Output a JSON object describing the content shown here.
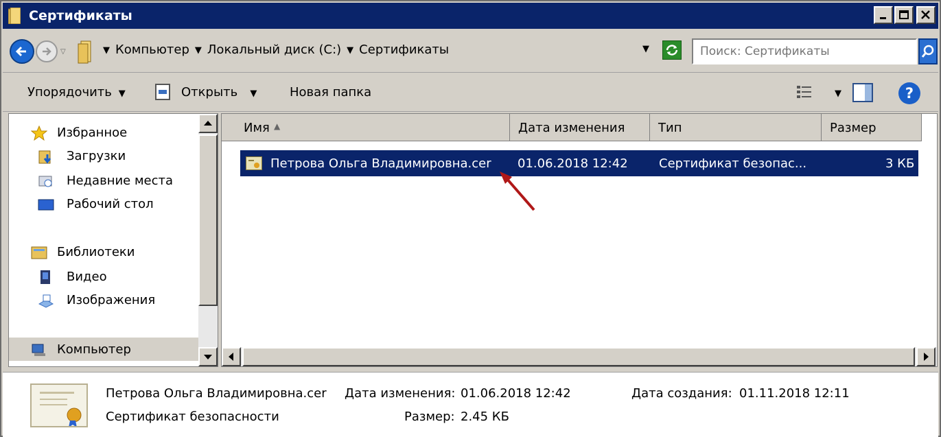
{
  "window": {
    "title": "Сертификаты",
    "controls": {
      "minimize": "minimize",
      "maximize": "maximize",
      "close": "close"
    }
  },
  "address": {
    "crumbs": [
      "Компьютер",
      "Локальный диск (C:)",
      "Сертификаты"
    ],
    "search_placeholder": "Поиск: Сертификаты"
  },
  "toolbar": {
    "organize_label": "Упорядочить",
    "open_label": "Открыть",
    "new_folder_label": "Новая папка"
  },
  "nav": {
    "favorites": "Избранное",
    "downloads": "Загрузки",
    "recent": "Недавние места",
    "desktop": "Рабочий стол",
    "libraries": "Библиотеки",
    "video": "Видео",
    "images": "Изображения",
    "computer": "Компьютер"
  },
  "columns": {
    "name": "Имя",
    "date": "Дата изменения",
    "type": "Тип",
    "size": "Размер"
  },
  "files": [
    {
      "name": "Петрова Ольга Владимировна.cer",
      "date": "01.06.2018 12:42",
      "type": "Сертификат безопас...",
      "size": "3 КБ"
    }
  ],
  "details": {
    "filename": "Петрова Ольга Владимировна.cer",
    "filetype": "Сертификат безопасности",
    "modified_label": "Дата изменения:",
    "modified_value": "01.06.2018 12:42",
    "size_label": "Размер:",
    "size_value": "2.45 КБ",
    "created_label": "Дата создания:",
    "created_value": "01.11.2018 12:11"
  },
  "colors": {
    "selection": "#0a246a",
    "titlebar": "#0a246a",
    "annotation_arrow": "#b01818"
  }
}
